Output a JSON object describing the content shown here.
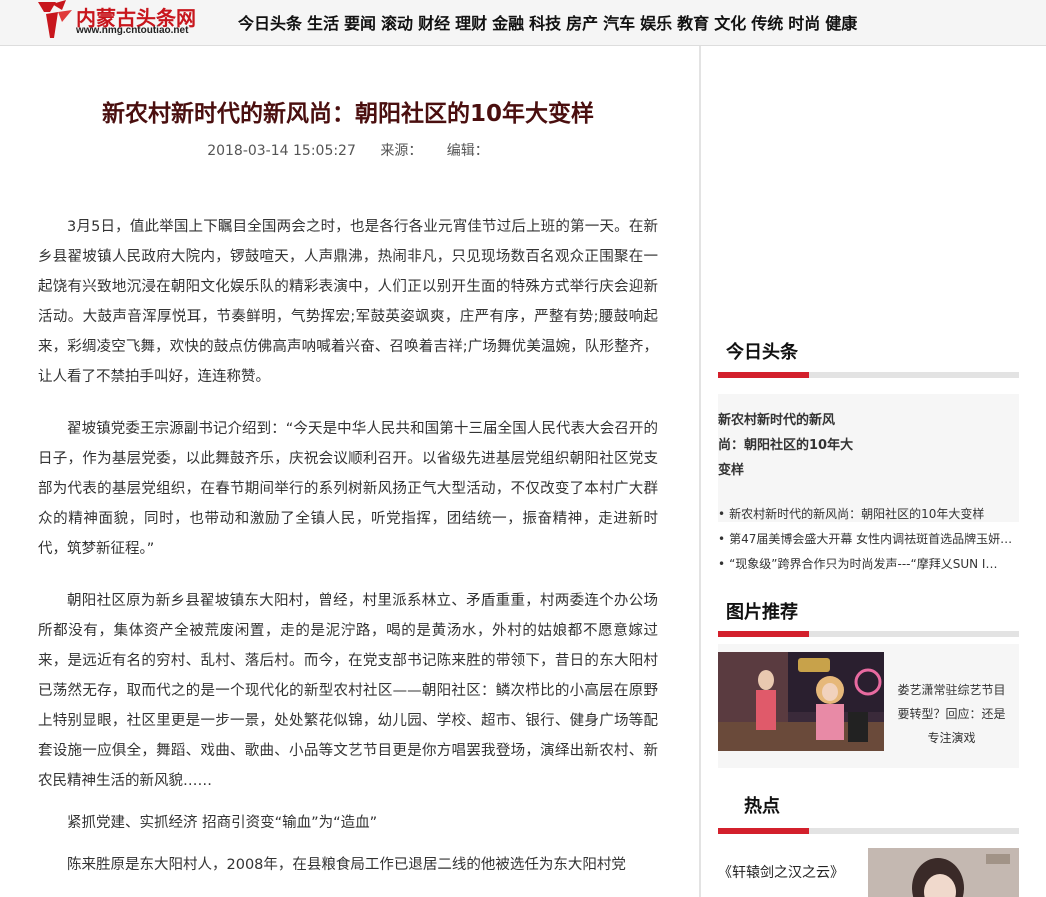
{
  "header": {
    "logo_name": "内蒙古头条网",
    "logo_url": "www.nmg.cntoutiao.net",
    "nav": [
      "今日头条",
      "生活",
      "要闻",
      "滚动",
      "财经",
      "理财",
      "金融",
      "科技",
      "房产",
      "汽车",
      "娱乐",
      "教育",
      "文化",
      "传统",
      "时尚",
      "健康"
    ]
  },
  "article": {
    "title": "新农村新时代的新风尚：朝阳社区的10年大变样",
    "datetime": "2018-03-14 15:05:27",
    "source_label": "来源：",
    "editor_label": "编辑：",
    "paragraphs": [
      "3月5日，值此举国上下瞩目全国两会之时，也是各行各业元宵佳节过后上班的第一天。在新乡县翟坡镇人民政府大院内，锣鼓喧天，人声鼎沸，热闹非凡，只见现场数百名观众正围聚在一起饶有兴致地沉浸在朝阳文化娱乐队的精彩表演中，人们正以别开生面的特殊方式举行庆会迎新活动。大鼓声音浑厚悦耳，节奏鲜明，气势挥宏;军鼓英姿飒爽，庄严有序，严整有势;腰鼓响起来，彩绸凌空飞舞，欢快的鼓点仿佛高声呐喊着兴奋、召唤着吉祥;广场舞优美温婉，队形整齐，让人看了不禁拍手叫好，连连称赞。",
      "翟坡镇党委王宗源副书记介绍到：“今天是中华人民共和国第十三届全国人民代表大会召开的日子，作为基层党委，以此舞鼓齐乐，庆祝会议顺利召开。以省级先进基层党组织朝阳社区党支部为代表的基层党组织，在春节期间举行的系列树新风扬正气大型活动，不仅改变了本村广大群众的精神面貌，同时，也带动和激励了全镇人民，听党指挥，团结统一，振奋精神，走进新时代，筑梦新征程。”",
      "朝阳社区原为新乡县翟坡镇东大阳村，曾经，村里派系林立、矛盾重重，村两委连个办公场所都没有，集体资产全被荒废闲置，走的是泥泞路，喝的是黄汤水，外村的姑娘都不愿意嫁过来，是远近有名的穷村、乱村、落后村。而今，在党支部书记陈来胜的带领下，昔日的东大阳村已荡然无存，取而代之的是一个现代化的新型农村社区——朝阳社区：鳞次栉比的小高层在原野上特别显眼，社区里更是一步一景，处处繁花似锦，幼儿园、学校、超市、银行、健身广场等配套设施一应俱全，舞蹈、戏曲、歌曲、小品等文艺节目更是你方唱罢我登场，演绎出新农村、新农民精神生活的新风貌……",
      "紧抓党建、实抓经济 招商引资变“输血”为“造血”",
      "陈来胜原是东大阳村人，2008年，在县粮食局工作已退居二线的他被选任为东大阳村党"
    ]
  },
  "sidebar": {
    "today_title": "今日头条",
    "headline": "新农村新时代的新风尚：朝阳社区的10年大变样",
    "news": [
      "新农村新时代的新风尚：朝阳社区的10年大变样",
      "第47届美博会盛大开幕 女性内调祛斑首选品牌玉妍…",
      "“现象级”跨界合作只为时尚发声---“摩拜乂SUN I…"
    ],
    "pic_title": "图片推荐",
    "pic_caption": "娄艺潇常驻综艺节目要转型？回应：还是专注演戏",
    "hot_title": "热点",
    "hot_item": "《轩辕剑之汉之云》"
  },
  "colors": {
    "brand_red": "#c8161d",
    "accent_red": "#d3202c",
    "title_dark": "#4a0f0f"
  }
}
